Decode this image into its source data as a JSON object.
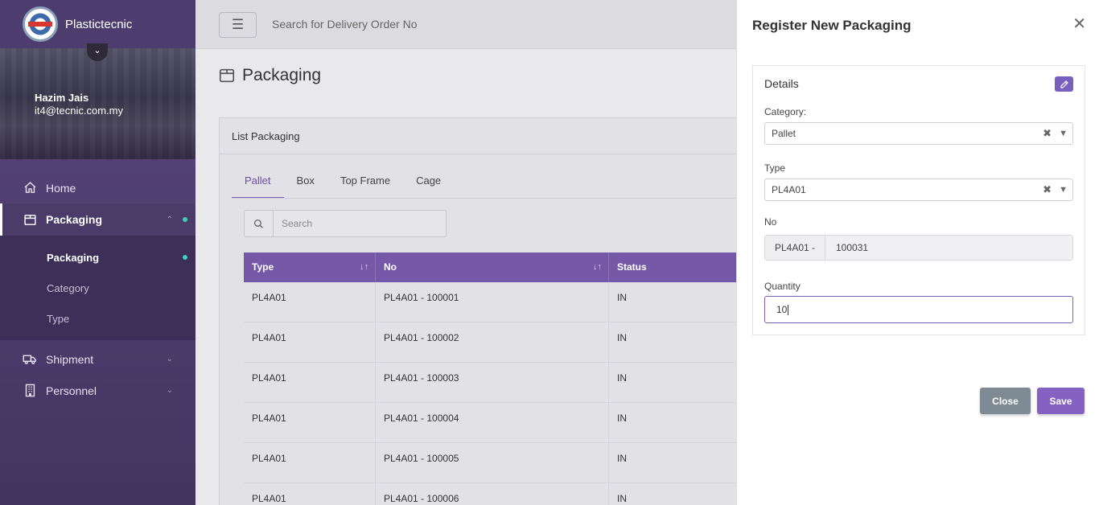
{
  "brand": {
    "name": "Plastictecnic"
  },
  "user": {
    "name": "Hazim Jais",
    "email": "it4@tecnic.com.my"
  },
  "sidebar": {
    "items": [
      {
        "label": "Home"
      },
      {
        "label": "Packaging"
      },
      {
        "label": "Shipment"
      },
      {
        "label": "Personnel"
      }
    ],
    "sub_items": [
      {
        "label": "Packaging"
      },
      {
        "label": "Category"
      },
      {
        "label": "Type"
      }
    ]
  },
  "topbar": {
    "search_placeholder": "Search for Delivery Order No"
  },
  "page": {
    "title": "Packaging"
  },
  "list": {
    "title": "List Packaging",
    "tabs": [
      {
        "label": "Pallet"
      },
      {
        "label": "Box"
      },
      {
        "label": "Top Frame"
      },
      {
        "label": "Cage"
      }
    ],
    "search_placeholder": "Search",
    "columns": [
      "Type",
      "No",
      "Status"
    ],
    "rows": [
      {
        "type": "PL4A01",
        "no": "PL4A01 - 100001",
        "status": "IN"
      },
      {
        "type": "PL4A01",
        "no": "PL4A01 - 100002",
        "status": "IN"
      },
      {
        "type": "PL4A01",
        "no": "PL4A01 - 100003",
        "status": "IN"
      },
      {
        "type": "PL4A01",
        "no": "PL4A01 - 100004",
        "status": "IN"
      },
      {
        "type": "PL4A01",
        "no": "PL4A01 - 100005",
        "status": "IN"
      },
      {
        "type": "PL4A01",
        "no": "PL4A01 - 100006",
        "status": "IN"
      }
    ]
  },
  "drawer": {
    "title": "Register New Packaging",
    "section_title": "Details",
    "category": {
      "label": "Category:",
      "value": "Pallet"
    },
    "type": {
      "label": "Type",
      "value": "PL4A01"
    },
    "no": {
      "label": "No",
      "prefix": "PL4A01 -",
      "value": "100031"
    },
    "quantity": {
      "label": "Quantity",
      "value": "10"
    },
    "close_label": "Close",
    "save_label": "Save"
  },
  "colors": {
    "accent": "#7a5fbf",
    "sidebar": "#4d3d6e",
    "close_button": "#7e8a94"
  }
}
